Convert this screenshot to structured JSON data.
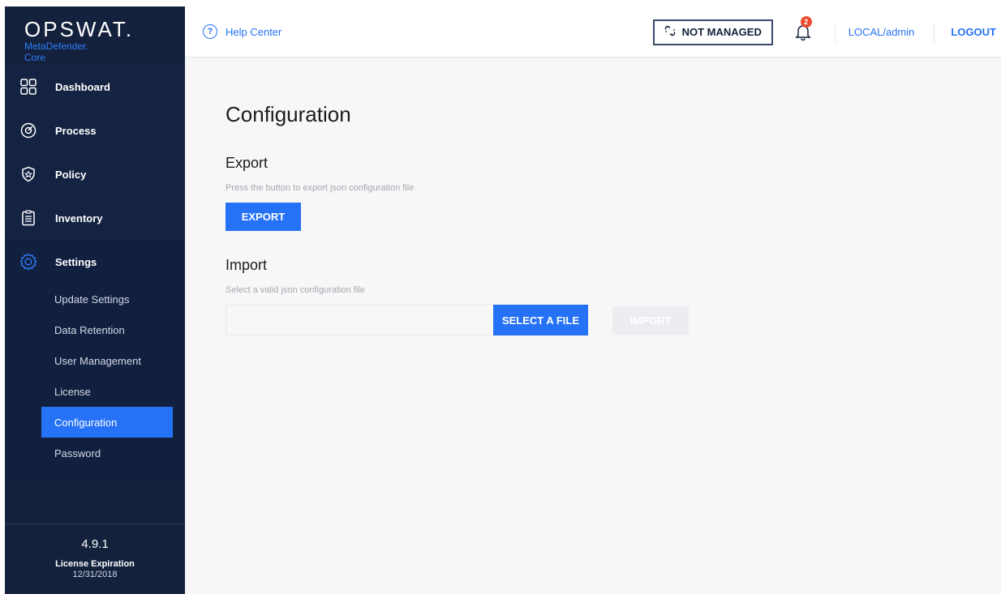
{
  "brand": {
    "logo": "OPSWAT.",
    "product": "MetaDefender.",
    "edition": "Core"
  },
  "sidebar": {
    "items": [
      {
        "label": "Dashboard",
        "icon": "dashboard-grid-icon"
      },
      {
        "label": "Process",
        "icon": "process-target-icon"
      },
      {
        "label": "Policy",
        "icon": "policy-shield-icon"
      },
      {
        "label": "Inventory",
        "icon": "inventory-clipboard-icon"
      },
      {
        "label": "Settings",
        "icon": "settings-gear-icon"
      }
    ],
    "settings_sub": [
      {
        "label": "Update Settings"
      },
      {
        "label": "Data Retention"
      },
      {
        "label": "User Management"
      },
      {
        "label": "License"
      },
      {
        "label": "Configuration"
      },
      {
        "label": "Password"
      }
    ],
    "active_sub": "Configuration"
  },
  "footer": {
    "version": "4.9.1",
    "license_title": "License Expiration",
    "license_date": "12/31/2018"
  },
  "topbar": {
    "help_label": "Help Center",
    "not_managed": "NOT MANAGED",
    "notifications_count": "2",
    "user": "LOCAL/admin",
    "logout": "LOGOUT"
  },
  "main": {
    "title": "Configuration",
    "export": {
      "heading": "Export",
      "hint": "Press the button to export json configuration file",
      "button": "EXPORT"
    },
    "import": {
      "heading": "Import",
      "hint": "Select a valid json configuration file",
      "select_button": "SELECT A FILE",
      "import_button": "IMPORT"
    }
  },
  "colors": {
    "sidebar_bg": "#14213d",
    "accent": "#2672f6",
    "badge": "#e84b2f"
  }
}
